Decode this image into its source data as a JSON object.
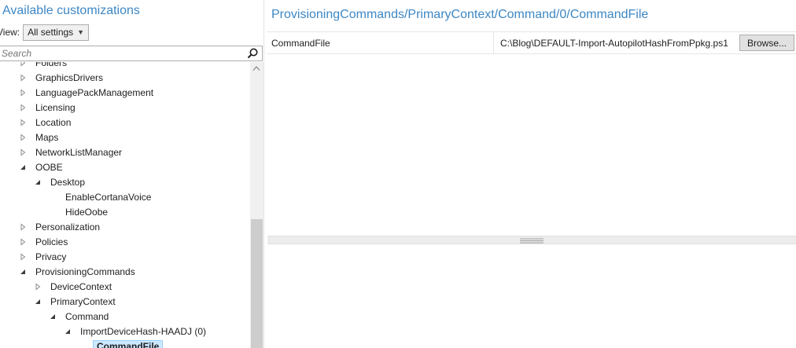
{
  "left": {
    "title": "Available customizations",
    "view_label": "View:",
    "view_selected": "All settings",
    "search_placeholder": "Search",
    "tree": [
      {
        "label": "Folders",
        "level": 0,
        "state": "collapsed"
      },
      {
        "label": "GraphicsDrivers",
        "level": 0,
        "state": "collapsed"
      },
      {
        "label": "LanguagePackManagement",
        "level": 0,
        "state": "collapsed"
      },
      {
        "label": "Licensing",
        "level": 0,
        "state": "collapsed"
      },
      {
        "label": "Location",
        "level": 0,
        "state": "collapsed"
      },
      {
        "label": "Maps",
        "level": 0,
        "state": "collapsed"
      },
      {
        "label": "NetworkListManager",
        "level": 0,
        "state": "collapsed"
      },
      {
        "label": "OOBE",
        "level": 0,
        "state": "expanded"
      },
      {
        "label": "Desktop",
        "level": 1,
        "state": "expanded"
      },
      {
        "label": "EnableCortanaVoice",
        "level": 2,
        "state": "leaf"
      },
      {
        "label": "HideOobe",
        "level": 2,
        "state": "leaf"
      },
      {
        "label": "Personalization",
        "level": 0,
        "state": "collapsed"
      },
      {
        "label": "Policies",
        "level": 0,
        "state": "collapsed"
      },
      {
        "label": "Privacy",
        "level": 0,
        "state": "collapsed"
      },
      {
        "label": "ProvisioningCommands",
        "level": 0,
        "state": "expanded"
      },
      {
        "label": "DeviceContext",
        "level": 1,
        "state": "collapsed"
      },
      {
        "label": "PrimaryContext",
        "level": 1,
        "state": "expanded"
      },
      {
        "label": "Command",
        "level": 2,
        "state": "expanded"
      },
      {
        "label": "ImportDeviceHash-HAADJ (0)",
        "level": 3,
        "state": "expanded"
      },
      {
        "label": "CommandFile",
        "level": 4,
        "state": "leaf",
        "selected": true
      }
    ]
  },
  "right": {
    "path_title": "ProvisioningCommands/PrimaryContext/Command/0/CommandFile",
    "setting_name": "CommandFile",
    "setting_value": "C:\\Blog\\DEFAULT-Import-AutopilotHashFromPpkg.ps1",
    "browse_label": "Browse..."
  },
  "colors": {
    "accent": "#3d87c4",
    "selection_bg": "#cce8ff",
    "selection_border": "#99d1ff"
  }
}
